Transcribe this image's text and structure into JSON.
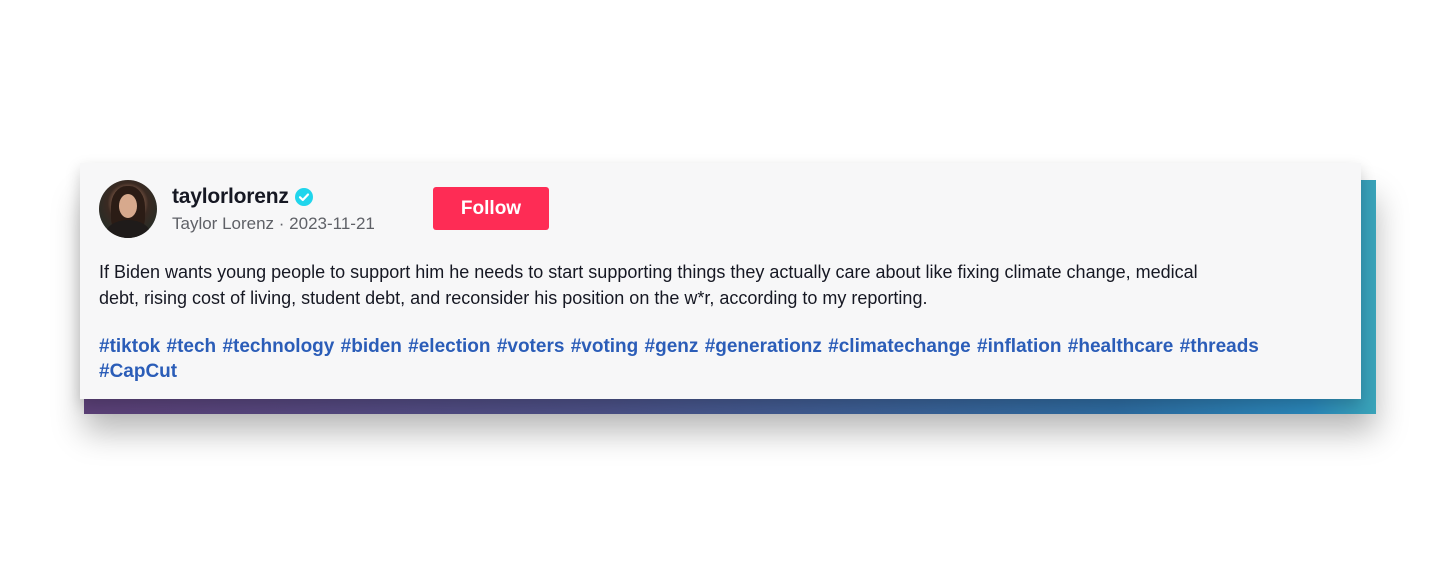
{
  "post": {
    "username": "taylorlorenz",
    "display_name": "Taylor Lorenz",
    "separator": " · ",
    "date": "2023-11-21",
    "follow_label": "Follow",
    "caption_line1": "If Biden wants young people to support him he needs to start supporting things they actually care about like fixing climate change, medical",
    "caption_line2": "debt, rising cost of living, student debt, and reconsider his position on the w*r, according to my reporting.",
    "hashtags": [
      "#tiktok",
      "#tech",
      "#technology",
      "#biden",
      "#election",
      "#voters",
      "#voting",
      "#genz",
      "#generationz",
      "#climatechange",
      "#inflation",
      "#healthcare",
      "#threads",
      "#CapCut"
    ]
  },
  "icons": {
    "verified": "verified-check-icon",
    "avatar": "profile-photo"
  },
  "colors": {
    "follow_button": "#fe2c55",
    "hashtag": "#2b5db8",
    "verified_badge": "#20d5ec",
    "card_background": "#f7f7f8"
  }
}
